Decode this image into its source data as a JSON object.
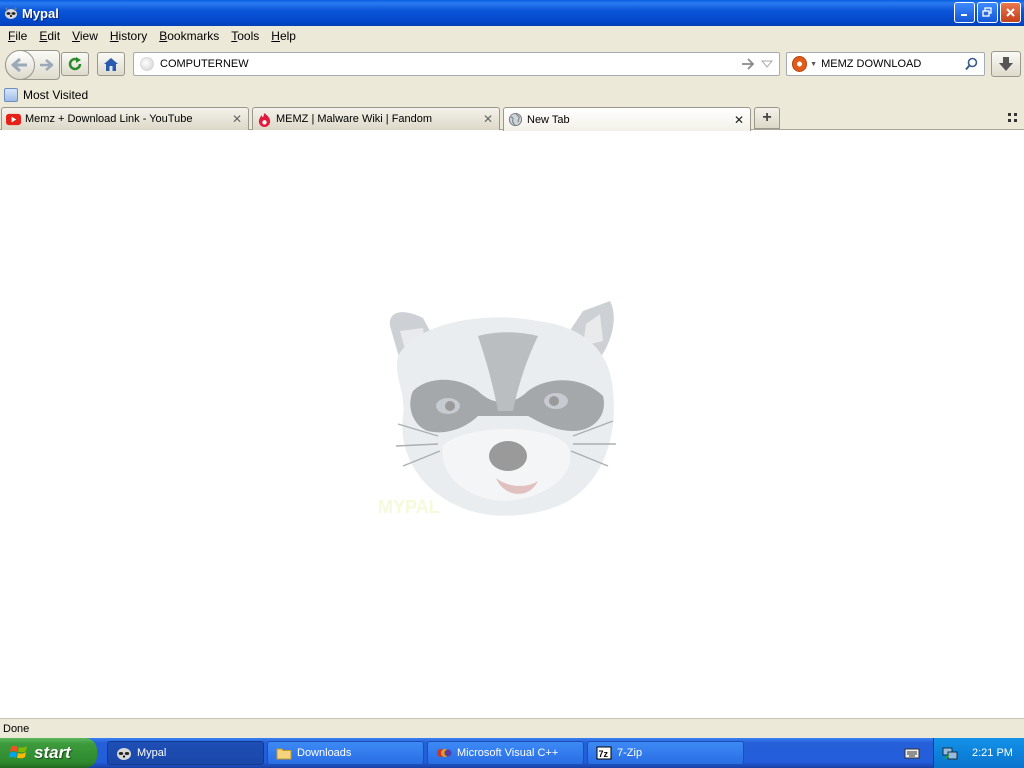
{
  "window": {
    "title": "Mypal"
  },
  "menu": {
    "items": [
      {
        "label": "File",
        "accel": "F",
        "rest": "ile"
      },
      {
        "label": "Edit",
        "accel": "E",
        "rest": "dit"
      },
      {
        "label": "View",
        "accel": "V",
        "rest": "iew"
      },
      {
        "label": "History",
        "accel": "H",
        "rest": "istory"
      },
      {
        "label": "Bookmarks",
        "accel": "B",
        "rest": "ookmarks"
      },
      {
        "label": "Tools",
        "accel": "T",
        "rest": "ools"
      },
      {
        "label": "Help",
        "accel": "H",
        "rest": "elp"
      }
    ]
  },
  "navbar": {
    "url_value": "COMPUTERNEW",
    "search_value": "MEMZ DOWNLOAD"
  },
  "bookmarks": {
    "most_visited": "Most Visited"
  },
  "tabs": [
    {
      "label": "Memz + Download Link - YouTube",
      "icon": "youtube-icon",
      "active": false
    },
    {
      "label": "MEMZ | Malware Wiki | Fandom",
      "icon": "fandom-icon",
      "active": false
    },
    {
      "label": "New Tab",
      "icon": "globe-icon",
      "active": true
    }
  ],
  "content": {
    "logo_caption": "MYPAL"
  },
  "status": {
    "text": "Done"
  },
  "taskbar": {
    "start_label": "start",
    "buttons": [
      {
        "label": "Mypal",
        "icon": "raccoon-icon",
        "active": true
      },
      {
        "label": "Downloads",
        "icon": "folder-icon",
        "active": false
      },
      {
        "label": "Microsoft Visual C++",
        "icon": "visual-cpp-icon",
        "active": false
      },
      {
        "label": "7-Zip",
        "icon": "7zip-icon",
        "active": false
      }
    ],
    "clock": "2:21 PM"
  },
  "colors": {
    "titlebar": "#0b56d9",
    "chrome": "#ece9d8",
    "taskbar": "#245ddb",
    "start": "#3c9a3c",
    "tray": "#0d82dc"
  }
}
